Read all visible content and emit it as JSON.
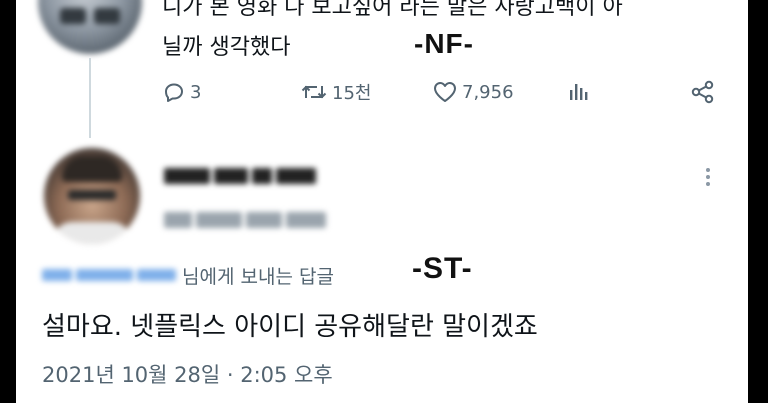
{
  "tweet_top": {
    "text_line1": "니가 본 영화 다 보고싶어 라는 말은 사랑고백이 아",
    "text_line2": "닐까 생각했다",
    "overlay_label": "-NF-",
    "actions": {
      "reply_count": "3",
      "retweet_count": "15천",
      "like_count": "7,956"
    },
    "icons": [
      "reply-icon",
      "retweet-icon",
      "like-icon",
      "analytics-icon",
      "share-icon"
    ]
  },
  "tweet_reply": {
    "overlay_label": "-ST-",
    "replying_to_suffix": "님에게 보내는 답글",
    "text": "설마요. 넷플릭스 아이디 공유해달란 말이겠죠",
    "timestamp": "2021년 10월 28일 · 2:05 오후",
    "icons": [
      "more-icon"
    ]
  },
  "colors": {
    "text_primary": "#0f1419",
    "text_secondary": "#536471",
    "mention_blue": "#1d9bf0",
    "thread_line": "#cfd9de",
    "frame": "#000000"
  }
}
